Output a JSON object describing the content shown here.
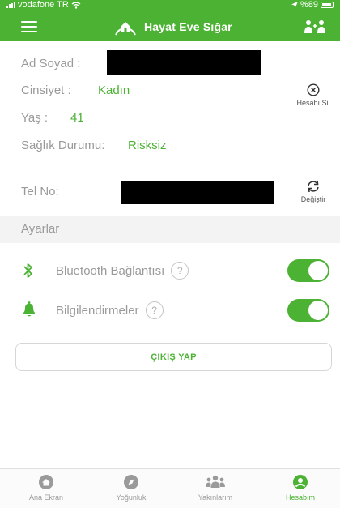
{
  "status_bar": {
    "carrier": "vodafone TR",
    "battery": "%89"
  },
  "header": {
    "title": "Hayat Eve Sığar"
  },
  "profile": {
    "name_label": "Ad Soyad :",
    "gender_label": "Cinsiyet :",
    "gender_value": "Kadın",
    "age_label": "Yaş :",
    "age_value": "41",
    "health_label": "Sağlık Durumu:",
    "health_value": "Risksiz",
    "delete_account_label": "Hesabı Sil",
    "phone_label": "Tel No:",
    "change_label": "Değiştir"
  },
  "settings": {
    "title": "Ayarlar",
    "bluetooth_label": "Bluetooth Bağlantısı",
    "bluetooth_on": true,
    "notifications_label": "Bilgilendirmeler",
    "notifications_on": true,
    "help_glyph": "?"
  },
  "logout_label": "ÇIKIŞ YAP",
  "tabs": [
    {
      "label": "Ana Ekran",
      "icon": "home-icon"
    },
    {
      "label": "Yoğunluk",
      "icon": "compass-icon"
    },
    {
      "label": "Yakınlarım",
      "icon": "group-icon"
    },
    {
      "label": "Hesabım",
      "icon": "user-icon",
      "active": true
    }
  ],
  "colors": {
    "brand_green": "#4cb234"
  }
}
